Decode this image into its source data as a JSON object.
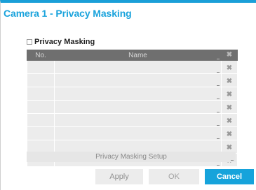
{
  "dialog": {
    "title": "Camera 1 - Privacy Masking",
    "privacy_masking_label": "Privacy Masking",
    "privacy_masking_checked": false
  },
  "table": {
    "headers": {
      "no": "No.",
      "name": "Name",
      "delete_icon": "close-icon"
    },
    "delete_glyph": "✖",
    "rows": [
      {
        "no": "",
        "name": ""
      },
      {
        "no": "",
        "name": ""
      },
      {
        "no": "",
        "name": ""
      },
      {
        "no": "",
        "name": ""
      },
      {
        "no": "",
        "name": ""
      },
      {
        "no": "",
        "name": ""
      },
      {
        "no": "",
        "name": ""
      },
      {
        "no": "",
        "name": ""
      }
    ]
  },
  "setup_button": {
    "label": "Privacy Masking Setup"
  },
  "buttons": {
    "apply": "Apply",
    "ok": "OK",
    "cancel": "Cancel"
  },
  "colors": {
    "accent": "#1aa3dc",
    "header_bg": "#6f6f6f",
    "row_bg": "#ececec",
    "cancel_bg": "#16a3db"
  }
}
